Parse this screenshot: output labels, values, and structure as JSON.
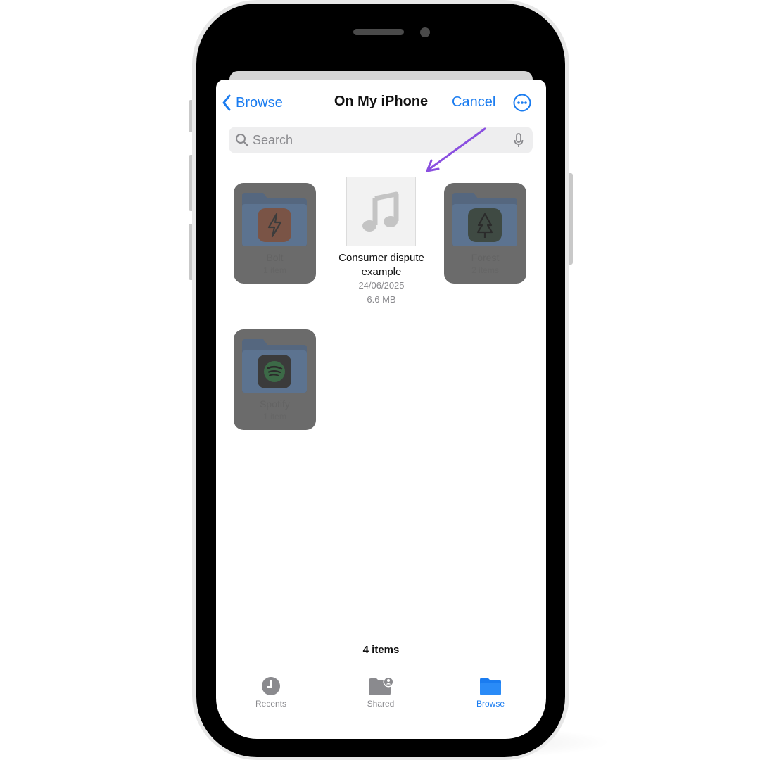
{
  "nav": {
    "back_label": "Browse",
    "title": "On My iPhone",
    "cancel_label": "Cancel",
    "more_icon": "ellipsis-circle-icon"
  },
  "search": {
    "placeholder": "Search"
  },
  "items": {
    "folders": [
      {
        "name": "Bolt",
        "meta": "1 item",
        "app_color": "#e8643c"
      },
      {
        "name": "Forest",
        "meta": "2 items",
        "app_color": "#3d4a3f"
      },
      {
        "name": "Spotify",
        "meta": "1 item",
        "app_color": "#1db954"
      }
    ],
    "file": {
      "name": "Consumer dispute example",
      "date": "24/06/2025",
      "size": "6.6 MB",
      "icon": "music-note-icon"
    }
  },
  "footer": {
    "count": "4 items"
  },
  "tabbar": {
    "tabs": [
      {
        "label": "Recents",
        "icon": "clock-icon",
        "active": false
      },
      {
        "label": "Shared",
        "icon": "shared-folder-icon",
        "active": false
      },
      {
        "label": "Browse",
        "icon": "folder-icon",
        "active": true
      }
    ]
  },
  "annotation": {
    "arrow_color": "#8a4fe0"
  }
}
